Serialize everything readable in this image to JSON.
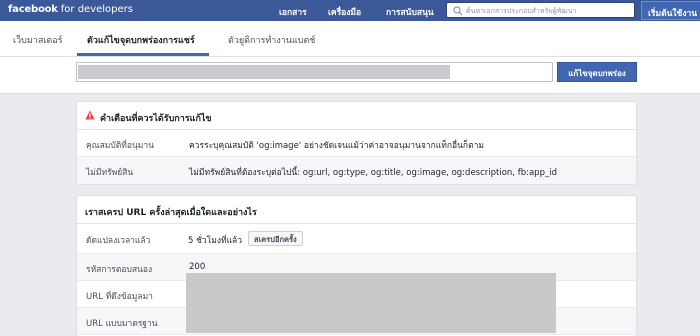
{
  "topbar": {
    "brand_bold": "facebook",
    "brand_rest": "for developers",
    "nav": [
      "เอกสาร",
      "เครื่องมือ",
      "การสนับสนุน"
    ],
    "search_placeholder": "ค้นหาเอกสารประกอบสำหรับผู้พัฒนา",
    "start_button": "เริ่มต้นใช้งาน"
  },
  "tabs": [
    "เว็บมาสเตอร์",
    "ตัวแก้ไขจุดบกพร่องการแชร์",
    "ตัวยูติการทำงานแบตช์"
  ],
  "url_area": {
    "debug_button": "แก้ไขจุดบกพร่อง"
  },
  "warnings": {
    "title": "คำเตือนที่ควรได้รับการแก้ไข",
    "rows": [
      {
        "label": "คุณสมบัติที่อนุมาน",
        "value": "ควรระบุคุณสมบัติ 'og:image' อย่างชัดเจนแม้ว่าค่าอาจอนุมานจากแท็กอื่นก็ตาม"
      },
      {
        "label": "ไม่มีทรัพย์สิน",
        "value": "ไม่มีทรัพย์สินที่ต้องระบุต่อไปนี้: og:url, og:type, og:title, og:image, og:description, fb:app_id"
      }
    ]
  },
  "scrape": {
    "title": "เราสเครป URL ครั้งล่าสุดเมื่อใดและอย่างไร",
    "rows": [
      {
        "label": "ดัดแปลงเวลาแล้ว",
        "value": "5 ชั่วโมงที่แล้ว"
      },
      {
        "label": "รหัสการตอบสนอง",
        "value": "200"
      },
      {
        "label": "URL ที่ดึงข้อมูลมา",
        "value": ""
      },
      {
        "label": "URL แบบมาตรฐาน",
        "value": ""
      }
    ],
    "rescrape_button": "สเครปอีกครั้ง"
  },
  "colors": {
    "brand": "#3b5998",
    "accent": "#4267b2",
    "warning": "#fa3e3e"
  }
}
